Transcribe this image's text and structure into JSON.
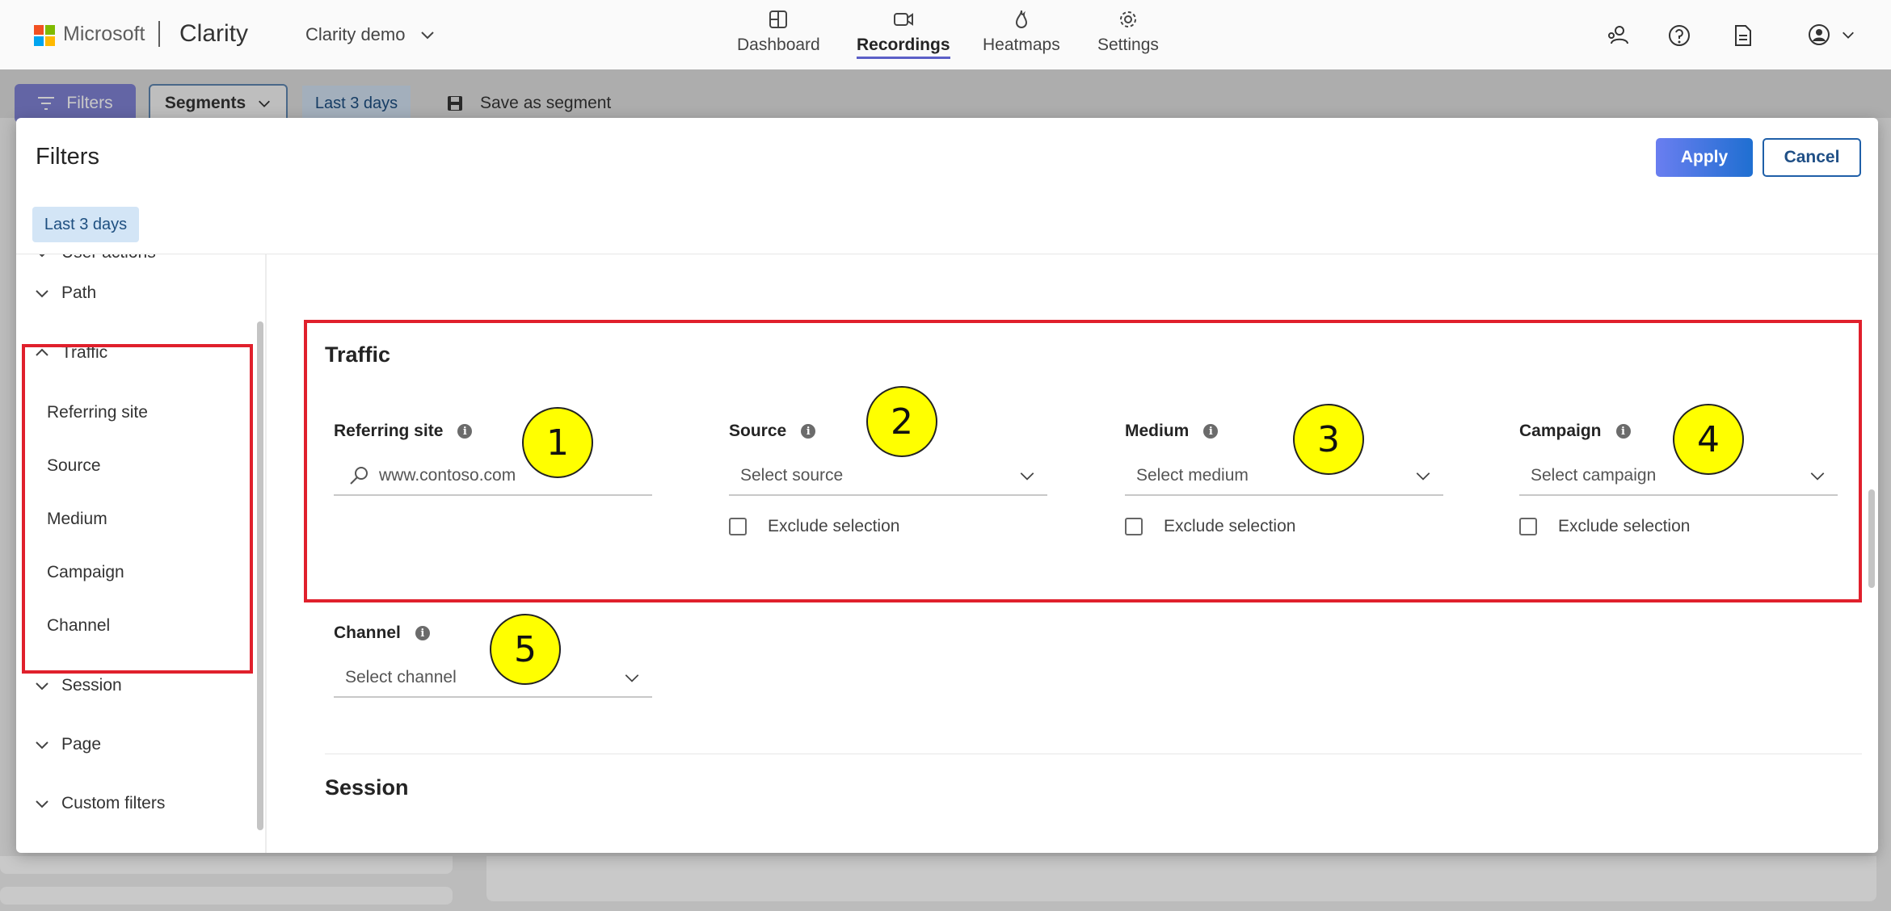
{
  "header": {
    "ms_text": "Microsoft",
    "app_name": "Clarity",
    "project_name": "Clarity demo",
    "nav": [
      {
        "label": "Dashboard",
        "icon": "grid-icon",
        "active": false
      },
      {
        "label": "Recordings",
        "icon": "video-icon",
        "active": true
      },
      {
        "label": "Heatmaps",
        "icon": "flame-icon",
        "active": false
      },
      {
        "label": "Settings",
        "icon": "gear-icon",
        "active": false
      }
    ],
    "ms_colors": [
      "#f25022",
      "#7fba00",
      "#00a4ef",
      "#ffb900"
    ]
  },
  "toolbar": {
    "filters_label": "Filters",
    "segments_label": "Segments",
    "date_label": "Last 3 days",
    "save_label": "Save as segment"
  },
  "modal": {
    "title": "Filters",
    "apply_label": "Apply",
    "cancel_label": "Cancel",
    "date_pill": "Last 3 days"
  },
  "sidebar": {
    "partial_section": "User actions",
    "sections": {
      "path": "Path",
      "traffic": "Traffic",
      "session": "Session",
      "page": "Page",
      "custom": "Custom filters"
    },
    "traffic_items": [
      "Referring site",
      "Source",
      "Medium",
      "Campaign",
      "Channel"
    ]
  },
  "main": {
    "traffic_title": "Traffic",
    "session_title": "Session",
    "fields": {
      "referring": {
        "label": "Referring site",
        "placeholder": "www.contoso.com"
      },
      "source": {
        "label": "Source",
        "placeholder": "Select source"
      },
      "medium": {
        "label": "Medium",
        "placeholder": "Select medium"
      },
      "campaign": {
        "label": "Campaign",
        "placeholder": "Select campaign"
      },
      "channel": {
        "label": "Channel",
        "placeholder": "Select channel"
      }
    },
    "exclude_label": "Exclude selection",
    "callouts": [
      "1",
      "2",
      "3",
      "4",
      "5"
    ]
  },
  "colors": {
    "accent": "#5b5fc7",
    "highlight_red": "#e0202c",
    "callout_yellow": "#ffff00"
  }
}
